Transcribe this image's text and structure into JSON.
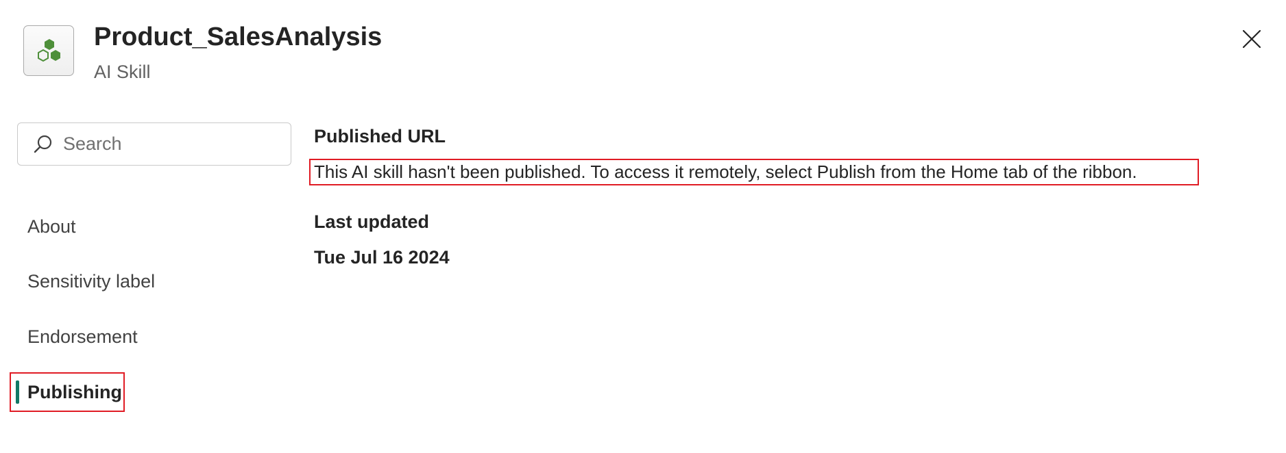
{
  "header": {
    "title": "Product_SalesAnalysis",
    "subtitle": "AI Skill",
    "icon": "ai-skill-hexagon-icon",
    "close_icon": "close-icon"
  },
  "search": {
    "placeholder": "Search",
    "value": "",
    "icon": "search-icon"
  },
  "nav": {
    "items": [
      {
        "label": "About",
        "selected": false
      },
      {
        "label": "Sensitivity label",
        "selected": false
      },
      {
        "label": "Endorsement",
        "selected": false
      },
      {
        "label": "Publishing",
        "selected": true
      }
    ]
  },
  "content": {
    "published_url_heading": "Published URL",
    "published_url_message": "This AI skill hasn't been published. To access it remotely, select Publish from the Home tab of the ribbon.",
    "last_updated_heading": "Last updated",
    "last_updated_value": "Tue Jul 16 2024"
  },
  "colors": {
    "accent": "#117865",
    "highlight_border": "#e01b24",
    "icon_green": "#4e8f3a"
  }
}
